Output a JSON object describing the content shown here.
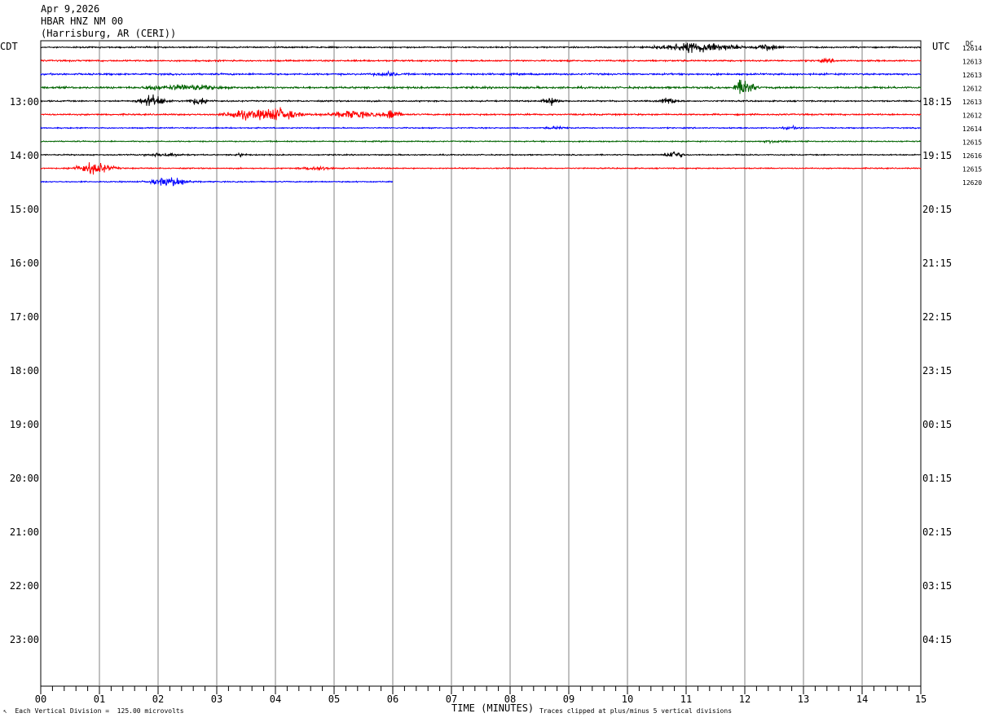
{
  "header": {
    "date": "Apr 9,2026",
    "channel": "HBAR HNZ NM 00",
    "location": "(Harrisburg, AR (CERI))"
  },
  "left_tz": "CDT",
  "right_tz": "UTC",
  "dc_label": "DC",
  "footer": {
    "scale_note": "Each Vertical Division =  125.00 microvolts",
    "xlabel": "TIME (MINUTES)",
    "clip_note": "Traces clipped at plus/minus 5 vertical divisions"
  },
  "colors": {
    "black": "#000000",
    "red": "#ff0000",
    "blue": "#0000ff",
    "green": "#006400",
    "grid": "#808080"
  },
  "chart_data": {
    "type": "line",
    "title": "HBAR HNZ NM 00",
    "xlabel": "TIME (MINUTES)",
    "xlim": [
      0,
      15
    ],
    "x_ticks": [
      "00",
      "01",
      "02",
      "03",
      "04",
      "05",
      "06",
      "07",
      "08",
      "09",
      "10",
      "11",
      "12",
      "13",
      "14",
      "15"
    ],
    "left_hour_labels": [
      "13:00",
      "14:00",
      "15:00",
      "16:00",
      "17:00",
      "18:00",
      "19:00",
      "20:00",
      "21:00",
      "22:00",
      "23:00"
    ],
    "right_hour_labels": [
      "18:15",
      "19:15",
      "20:15",
      "21:15",
      "22:15",
      "23:15",
      "00:15",
      "01:15",
      "02:15",
      "03:15",
      "04:15"
    ],
    "first_left_label_row": 4,
    "rows_per_hour": 4,
    "traces": [
      {
        "color": "black",
        "dc": "12614",
        "end": 15,
        "noise": 0.35,
        "events": [
          [
            11.2,
            0.5,
            2.6
          ],
          [
            12.4,
            0.15,
            1.5
          ]
        ]
      },
      {
        "color": "red",
        "dc": "12613",
        "end": 15,
        "noise": 0.4,
        "events": [
          [
            13.4,
            0.12,
            0.8
          ]
        ]
      },
      {
        "color": "blue",
        "dc": "12613",
        "end": 15,
        "noise": 0.45,
        "events": [
          [
            5.9,
            0.15,
            1.0
          ]
        ]
      },
      {
        "color": "green",
        "dc": "12612",
        "end": 15,
        "noise": 0.5,
        "events": [
          [
            2.5,
            0.4,
            1.3
          ],
          [
            1.9,
            0.1,
            1.0
          ],
          [
            12.0,
            0.12,
            5.0
          ]
        ]
      },
      {
        "color": "black",
        "dc": "12613",
        "end": 15,
        "noise": 0.35,
        "events": [
          [
            1.9,
            0.18,
            3.0
          ],
          [
            2.7,
            0.15,
            1.8
          ],
          [
            8.7,
            0.12,
            1.8
          ],
          [
            10.7,
            0.12,
            1.8
          ]
        ]
      },
      {
        "color": "red",
        "dc": "12612",
        "end": 15,
        "noise": 0.4,
        "events": [
          [
            3.4,
            0.2,
            2.4
          ],
          [
            4.0,
            0.3,
            3.5
          ],
          [
            5.3,
            0.35,
            1.8
          ],
          [
            6.0,
            0.1,
            3.2
          ]
        ]
      },
      {
        "color": "blue",
        "dc": "12614",
        "end": 15,
        "noise": 0.3,
        "events": [
          [
            8.8,
            0.15,
            0.6
          ],
          [
            12.8,
            0.15,
            0.6
          ]
        ]
      },
      {
        "color": "green",
        "dc": "12615",
        "end": 15,
        "noise": 0.3,
        "events": [
          [
            12.5,
            0.15,
            0.6
          ]
        ]
      },
      {
        "color": "black",
        "dc": "12616",
        "end": 15,
        "noise": 0.3,
        "events": [
          [
            2.1,
            0.3,
            0.8
          ],
          [
            3.4,
            0.08,
            0.8
          ],
          [
            10.8,
            0.12,
            2.0
          ]
        ]
      },
      {
        "color": "red",
        "dc": "12615",
        "end": 15,
        "noise": 0.3,
        "events": [
          [
            0.9,
            0.25,
            3.0
          ],
          [
            4.7,
            0.2,
            1.0
          ]
        ]
      },
      {
        "color": "blue",
        "dc": "12620",
        "end": 6,
        "noise": 0.3,
        "events": [
          [
            2.2,
            0.25,
            2.5
          ]
        ]
      }
    ]
  }
}
